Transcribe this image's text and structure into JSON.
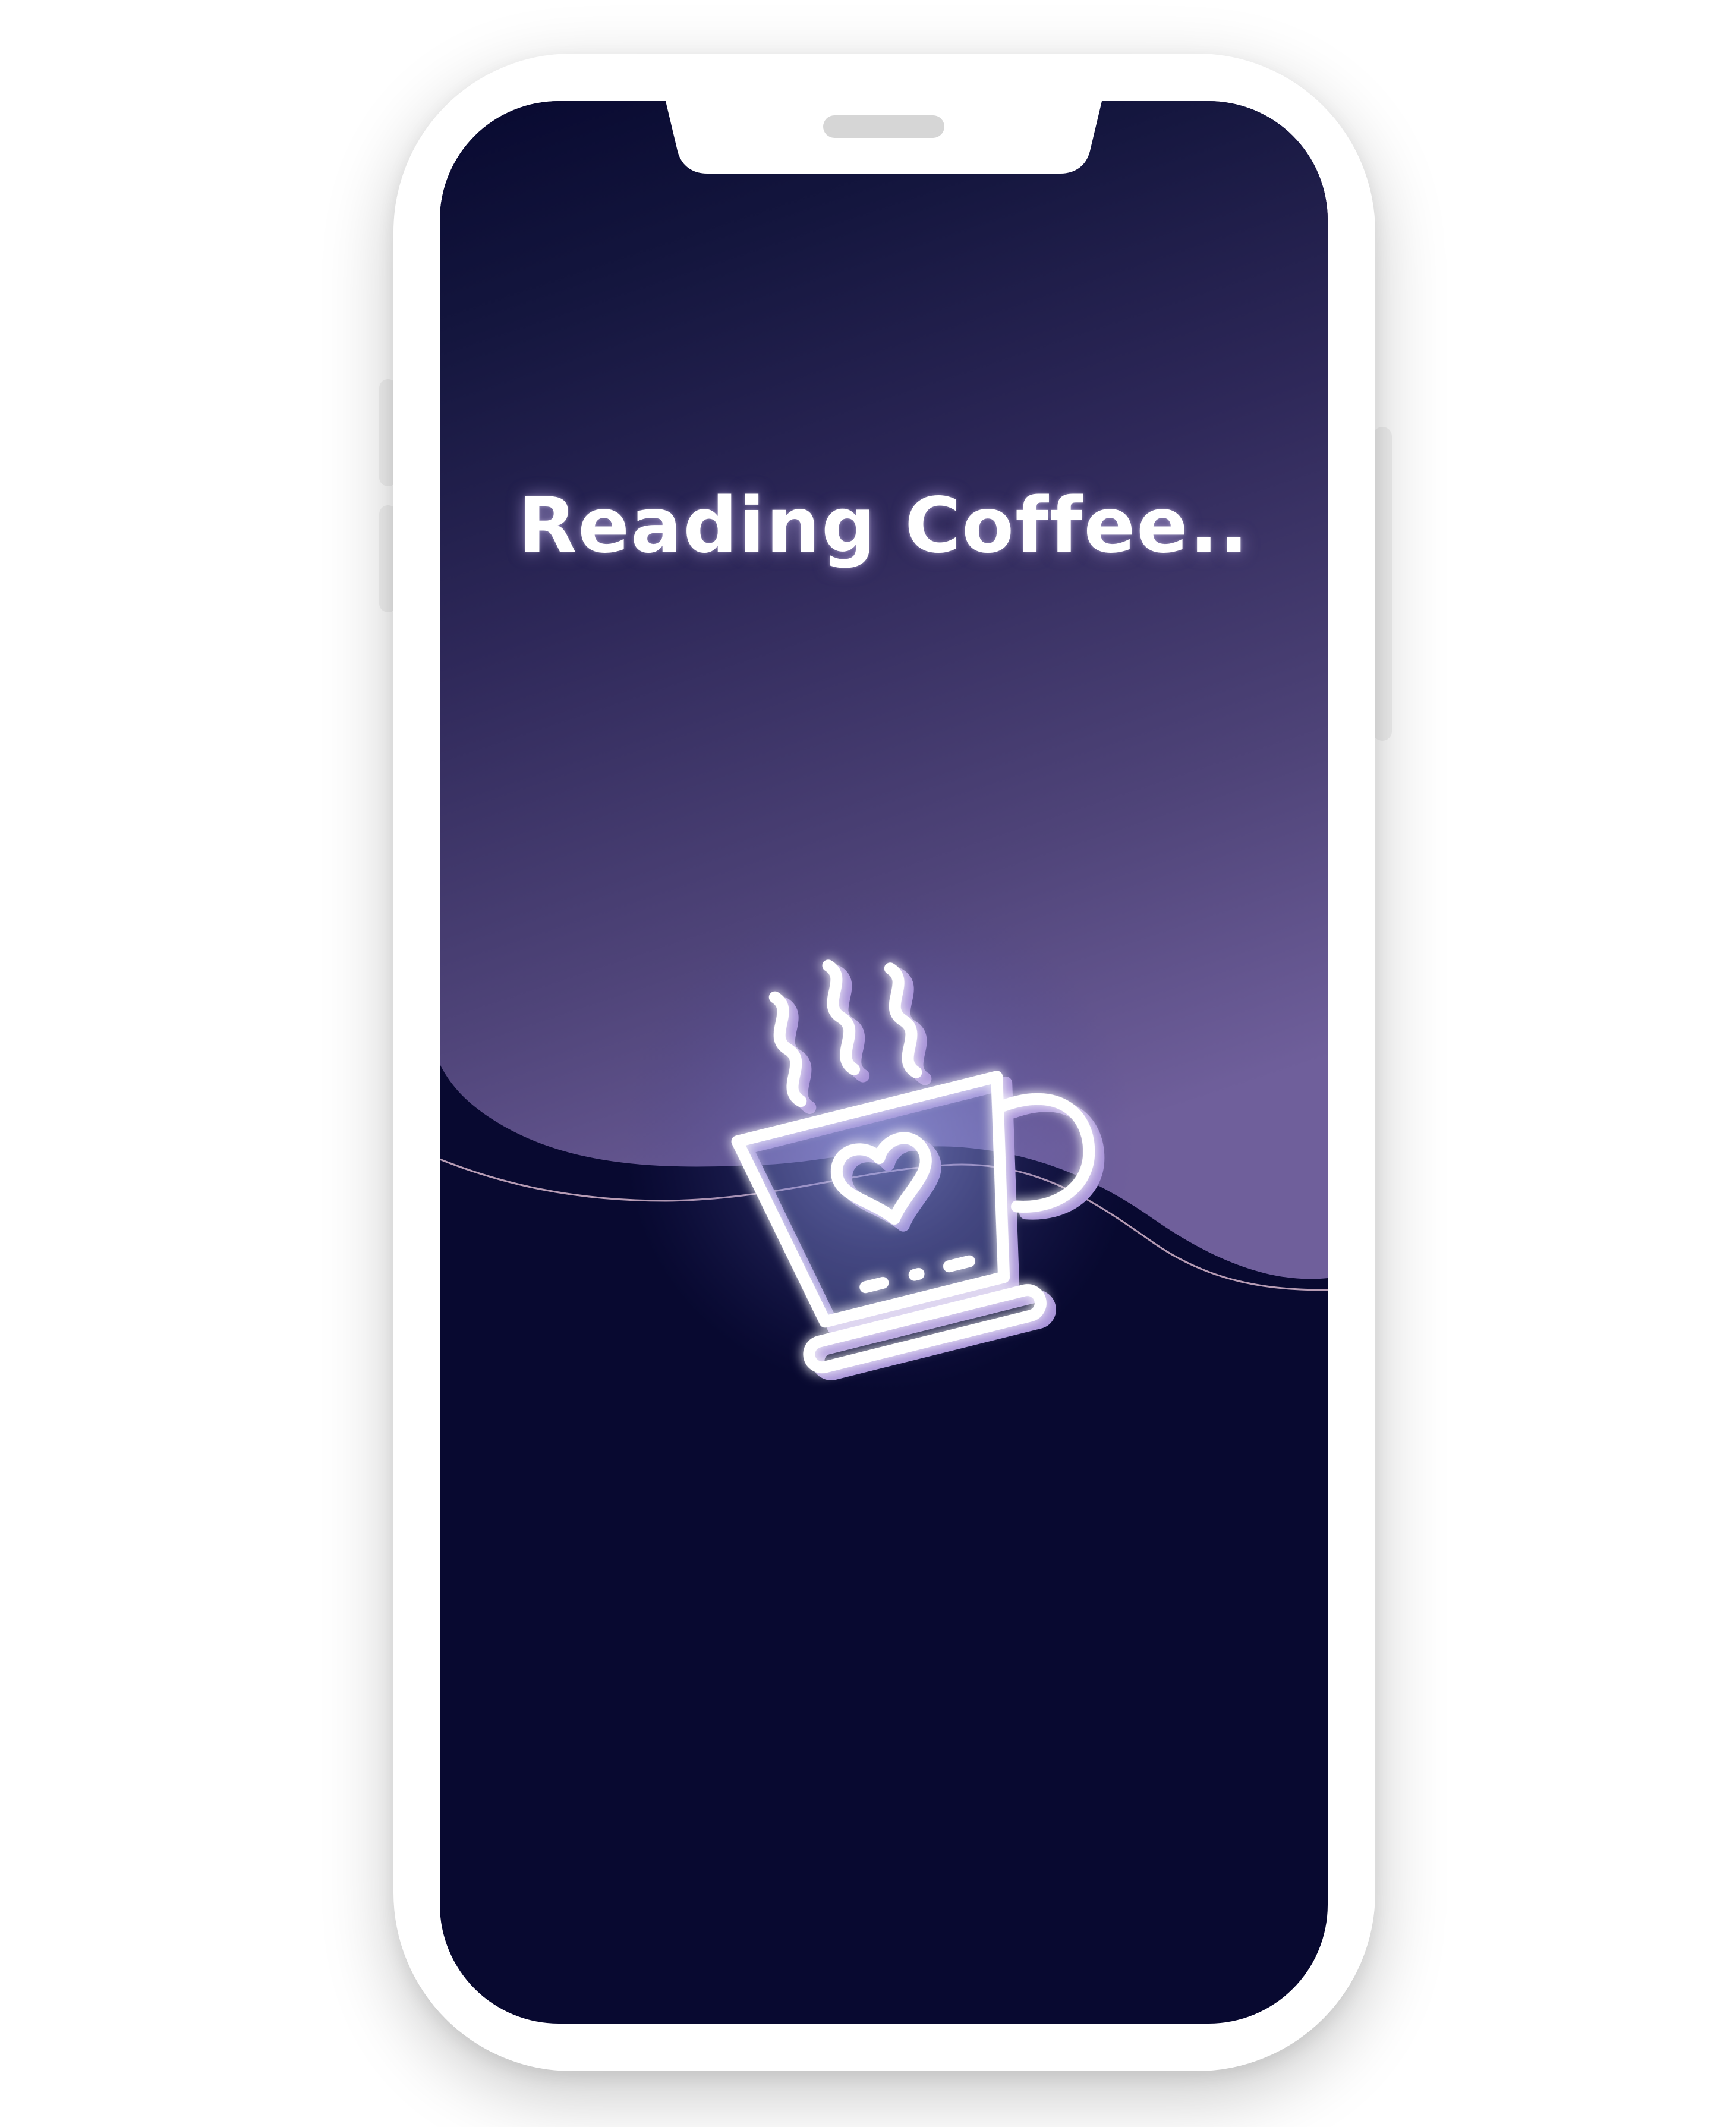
{
  "splash": {
    "title": "Reading Coffee.."
  },
  "icons": {
    "logo": "coffee-cup-heart-icon"
  },
  "colors": {
    "background_dark": "#080930",
    "background_purple": "#6e5e99",
    "glow": "#a694d6",
    "device_frame": "#ffffff"
  }
}
